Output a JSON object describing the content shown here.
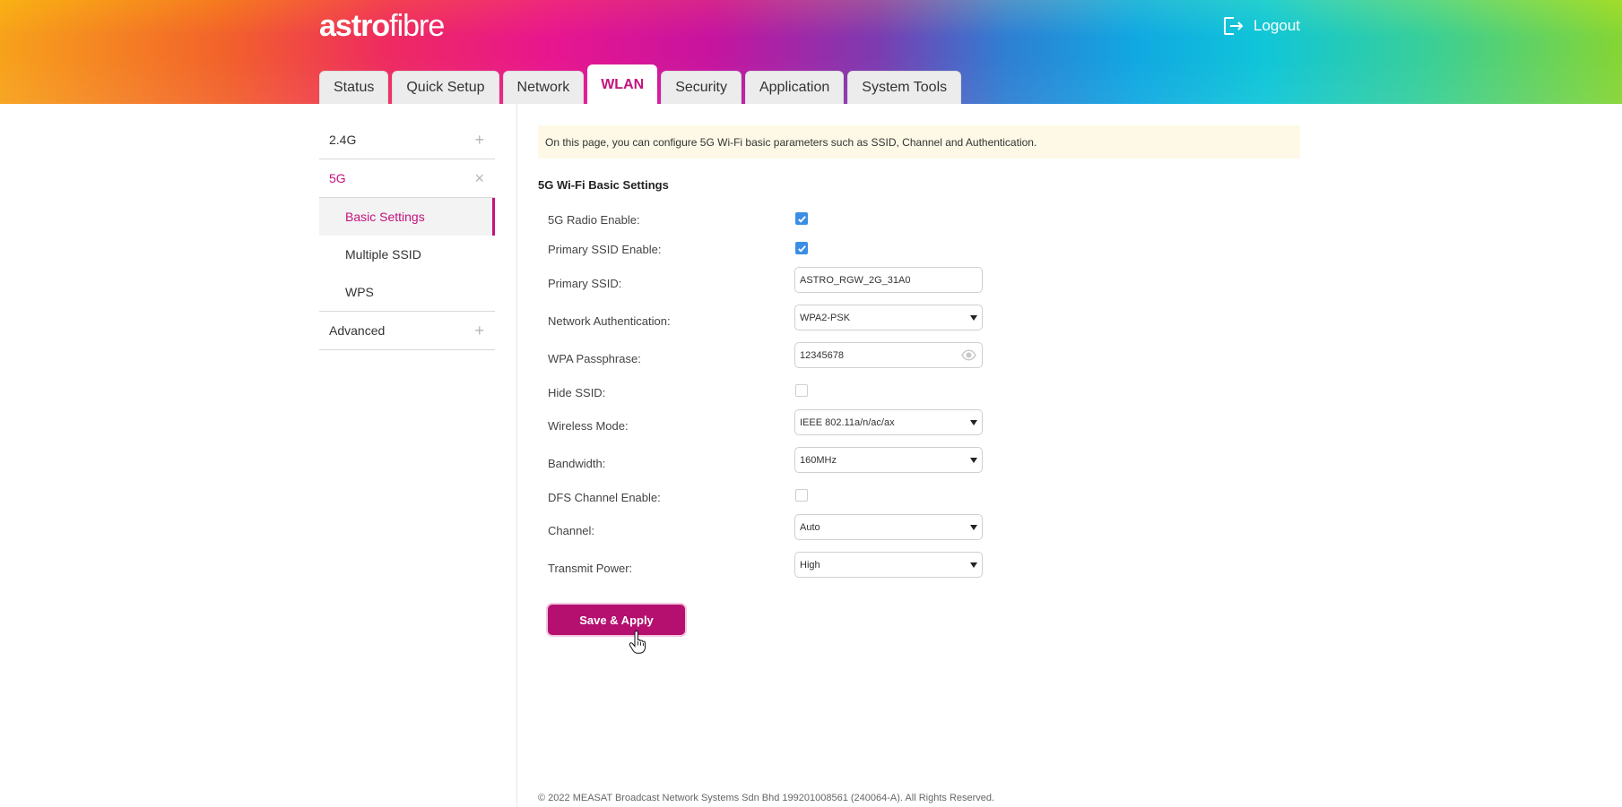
{
  "header": {
    "logo_part1": "astro",
    "logo_part2": "fibre",
    "logout_label": "Logout",
    "tabs": [
      {
        "label": "Status"
      },
      {
        "label": "Quick Setup"
      },
      {
        "label": "Network"
      },
      {
        "label": "WLAN"
      },
      {
        "label": "Security"
      },
      {
        "label": "Application"
      },
      {
        "label": "System Tools"
      }
    ],
    "active_tab": "WLAN"
  },
  "sidebar": {
    "sections": [
      {
        "label": "2.4G",
        "sign": "+"
      },
      {
        "label": "5G",
        "sign": "×"
      },
      {
        "label": "Advanced",
        "sign": "+"
      }
    ],
    "sub_items": [
      {
        "label": "Basic Settings"
      },
      {
        "label": "Multiple SSID"
      },
      {
        "label": "WPS"
      }
    ]
  },
  "main": {
    "note": "On this page, you can configure 5G Wi-Fi basic parameters such as SSID, Channel and Authentication.",
    "section_title": "5G Wi-Fi Basic Settings",
    "fields": {
      "radio_enable": {
        "label": "5G Radio Enable:",
        "checked": true
      },
      "primary_ssid_enable": {
        "label": "Primary SSID Enable:",
        "checked": true
      },
      "primary_ssid": {
        "label": "Primary SSID:",
        "value": "ASTRO_RGW_2G_31A0"
      },
      "network_auth": {
        "label": "Network Authentication:",
        "value": "WPA2-PSK"
      },
      "wpa_passphrase": {
        "label": "WPA Passphrase:",
        "value": "12345678"
      },
      "hide_ssid": {
        "label": "Hide SSID:",
        "checked": false
      },
      "wireless_mode": {
        "label": "Wireless Mode:",
        "value": "IEEE 802.11a/n/ac/ax"
      },
      "bandwidth": {
        "label": "Bandwidth:",
        "value": "160MHz"
      },
      "dfs_channel_enable": {
        "label": "DFS Channel Enable:",
        "checked": false
      },
      "channel": {
        "label": "Channel:",
        "value": "Auto"
      },
      "transmit_power": {
        "label": "Transmit Power:",
        "value": "High"
      }
    },
    "save_label": "Save & Apply"
  },
  "footer": {
    "copyright": "© 2022 MEASAT Broadcast Network Systems Sdn Bhd 199201008561 (240064-A). All Rights Reserved."
  },
  "colors": {
    "accent": "#c4127d",
    "button": "#b5106f",
    "checkbox": "#3c8ee5",
    "note_bg": "#fdf9e6"
  },
  "icons": {
    "logout": "logout-icon",
    "eye": "eye-icon",
    "caret": "chevron-down-icon",
    "checkmark": "checkmark-icon",
    "pointer": "hand-cursor-icon"
  }
}
